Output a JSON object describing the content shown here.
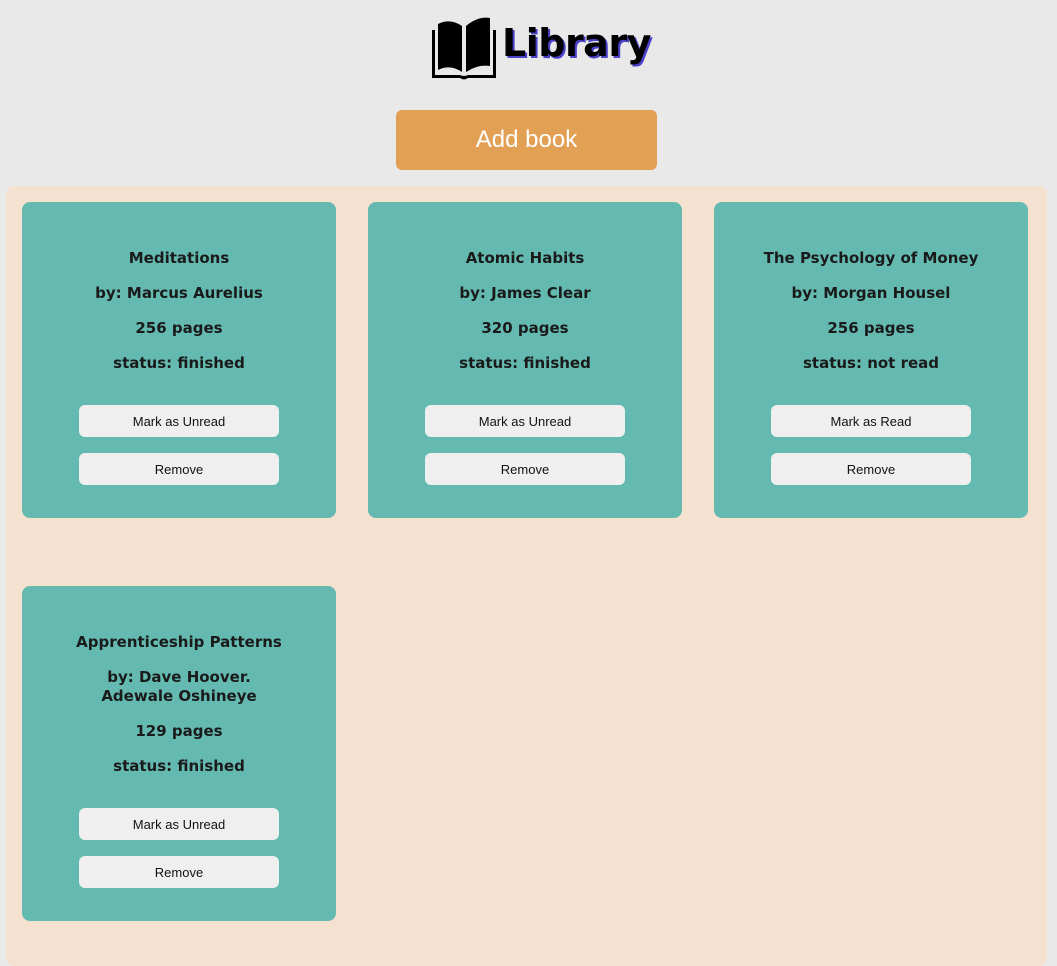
{
  "header": {
    "title": "Library",
    "logo_icon": "open-book-icon"
  },
  "add_button_label": "Add book",
  "colors": {
    "page_bg": "#e9e9e9",
    "library_bg": "#f5e1cf",
    "card_bg": "#64bab1",
    "add_button_bg": "#e2a055",
    "button_bg": "#efefef"
  },
  "books": [
    {
      "title": "Meditations",
      "author": "by: Marcus Aurelius",
      "pages": "256 pages",
      "status": "status: finished",
      "toggle_label": "Mark as Unread",
      "remove_label": "Remove"
    },
    {
      "title": "Atomic Habits",
      "author": "by: James Clear",
      "pages": "320 pages",
      "status": "status: finished",
      "toggle_label": "Mark as Unread",
      "remove_label": "Remove"
    },
    {
      "title": "The Psychology of Money",
      "author": "by: Morgan Housel",
      "pages": "256 pages",
      "status": "status: not read",
      "toggle_label": "Mark as Read",
      "remove_label": "Remove"
    },
    {
      "title": "Apprenticeship Patterns",
      "author": "by: Dave Hoover. Adewale Oshineye",
      "pages": "129 pages",
      "status": "status: finished",
      "toggle_label": "Mark as Unread",
      "remove_label": "Remove"
    }
  ]
}
